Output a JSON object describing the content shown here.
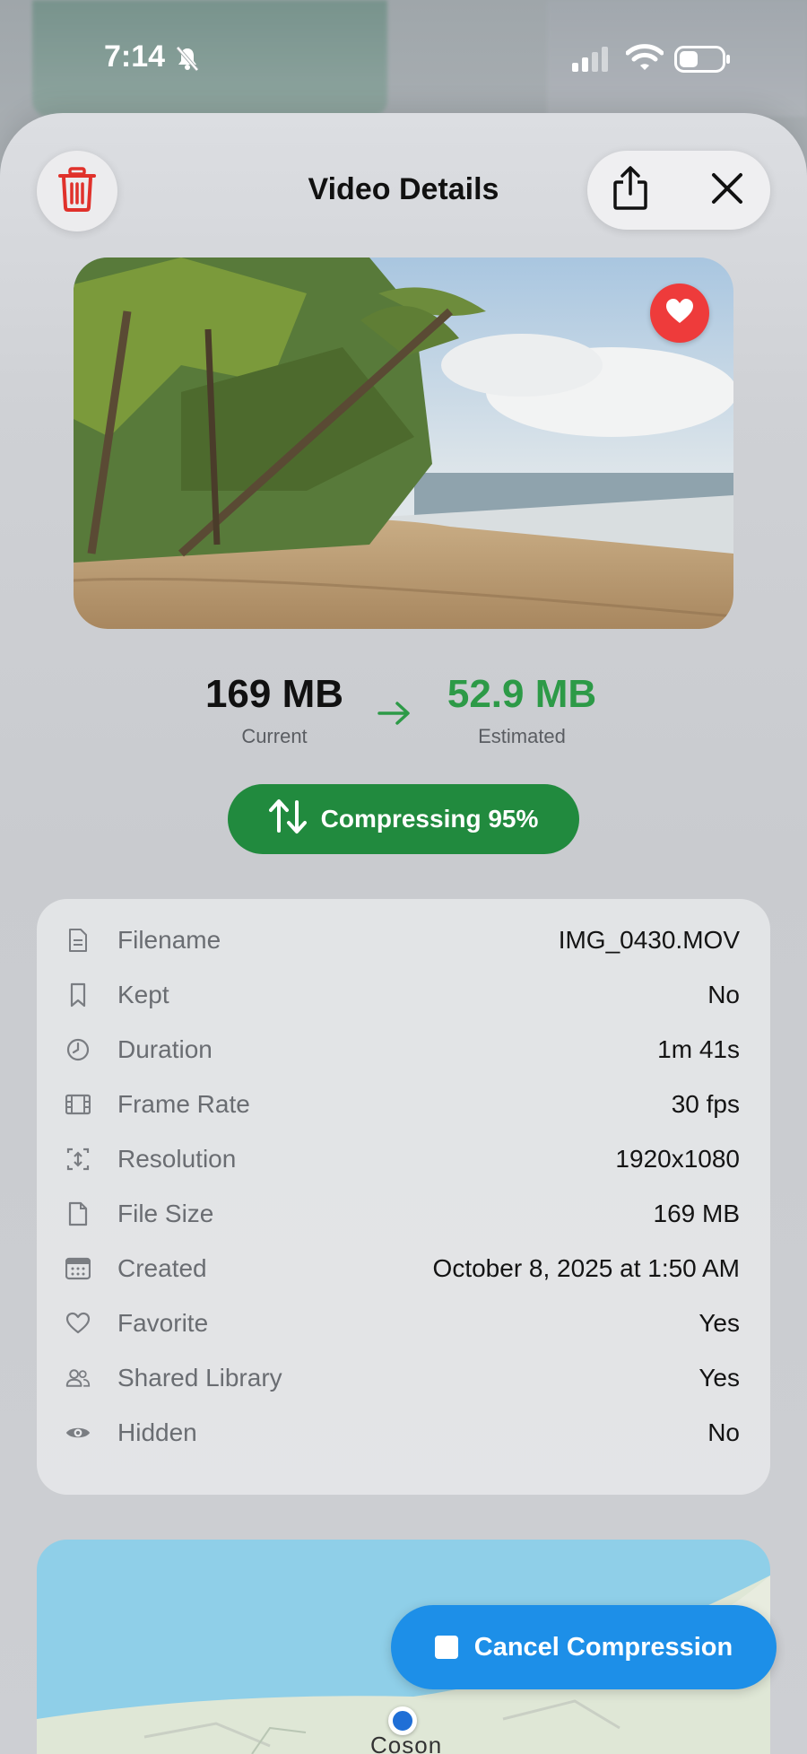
{
  "status_bar": {
    "time": "7:14",
    "icons": [
      "bell-slash-icon",
      "cellular-signal-icon",
      "wifi-icon",
      "battery-icon"
    ]
  },
  "header": {
    "title": "Video Details",
    "delete_icon": "trash-icon",
    "share_icon": "share-icon",
    "close_icon": "close-icon"
  },
  "thumbnail": {
    "favorite_icon": "heart-icon",
    "favorite_color": "#ee3b3b"
  },
  "sizes": {
    "current_value": "169 MB",
    "current_label": "Current",
    "estimated_value": "52.9 MB",
    "estimated_label": "Estimated",
    "estimated_color": "#2d9a47"
  },
  "compression": {
    "label": "Compressing 95%",
    "progress_percent": 95,
    "color": "#218a3e"
  },
  "details": {
    "rows": [
      {
        "icon": "document-icon",
        "label": "Filename",
        "value": "IMG_0430.MOV"
      },
      {
        "icon": "bookmark-icon",
        "label": "Kept",
        "value": "No"
      },
      {
        "icon": "clock-icon",
        "label": "Duration",
        "value": "1m 41s"
      },
      {
        "icon": "film-icon",
        "label": "Frame Rate",
        "value": "30 fps"
      },
      {
        "icon": "resize-icon",
        "label": "Resolution",
        "value": "1920x1080"
      },
      {
        "icon": "file-icon",
        "label": "File Size",
        "value": "169 MB"
      },
      {
        "icon": "calendar-icon",
        "label": "Created",
        "value": "October 8, 2025 at 1:50 AM"
      },
      {
        "icon": "heart-outline-icon",
        "label": "Favorite",
        "value": "Yes"
      },
      {
        "icon": "people-icon",
        "label": "Shared Library",
        "value": "Yes"
      },
      {
        "icon": "eye-icon",
        "label": "Hidden",
        "value": "No"
      }
    ]
  },
  "map": {
    "place_label": "Coson"
  },
  "cancel_button": {
    "label": "Cancel Compression",
    "color": "#1d8fe8"
  }
}
